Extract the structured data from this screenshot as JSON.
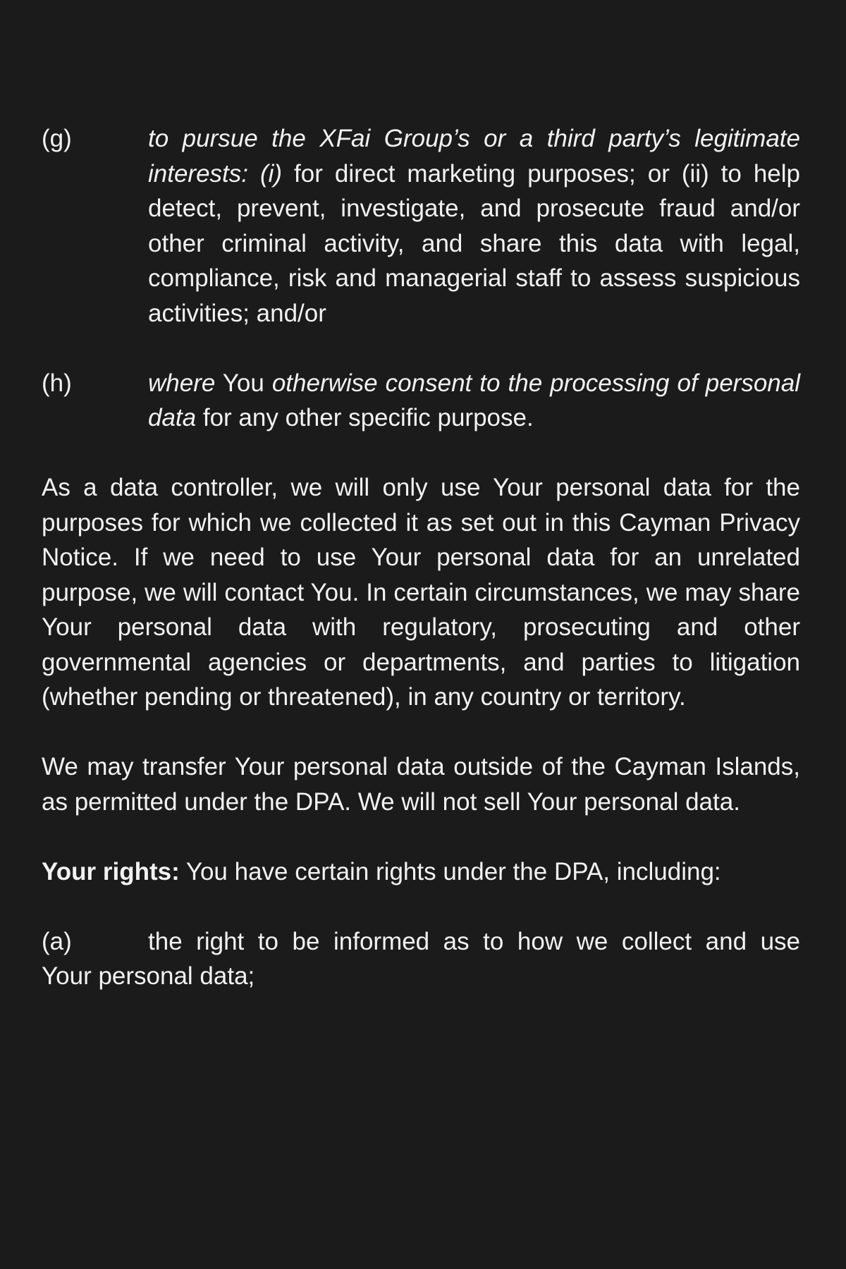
{
  "item_g": {
    "marker": "(g)",
    "italic_1": "to pursue the XFai Group’s or a third party’s legitimate interests:",
    "space_1": " ",
    "italic_2": "(i)",
    "text_1": " for direct marketing purposes; or (ii) to help detect, prevent, investigate, and prosecute fraud and/or other criminal activity, and share this data with legal, compliance, risk and managerial staff to assess suspicious activities; and/or"
  },
  "item_h": {
    "marker": "(h)",
    "italic_1": "where",
    "text_1": " You ",
    "italic_2": "otherwise consent to the processing of personal data",
    "text_2": " for any other specific purpose."
  },
  "paragraph_1": "As a data controller, we will only use Your personal data for the purposes for which we collected it as set out in this Cayman Privacy Notice. If we need to use Your personal data for an unrelated purpose, we will contact You. In certain circumstances, we may share Your personal data with regulatory, prosecuting and other governmental agencies or departments, and parties to litigation (whether pending or threatened), in any country or territory.",
  "paragraph_2": "We may transfer Your personal data outside of the Cayman Islands, as permitted under the DPA. We will not sell Your personal data.",
  "rights": {
    "heading": "Your rights:",
    "text": " You have certain rights under the DPA, including:"
  },
  "item_a": {
    "marker": "(a)",
    "line_1": "the right to be informed as to how we collect and use",
    "line_2": "Your personal data;"
  }
}
